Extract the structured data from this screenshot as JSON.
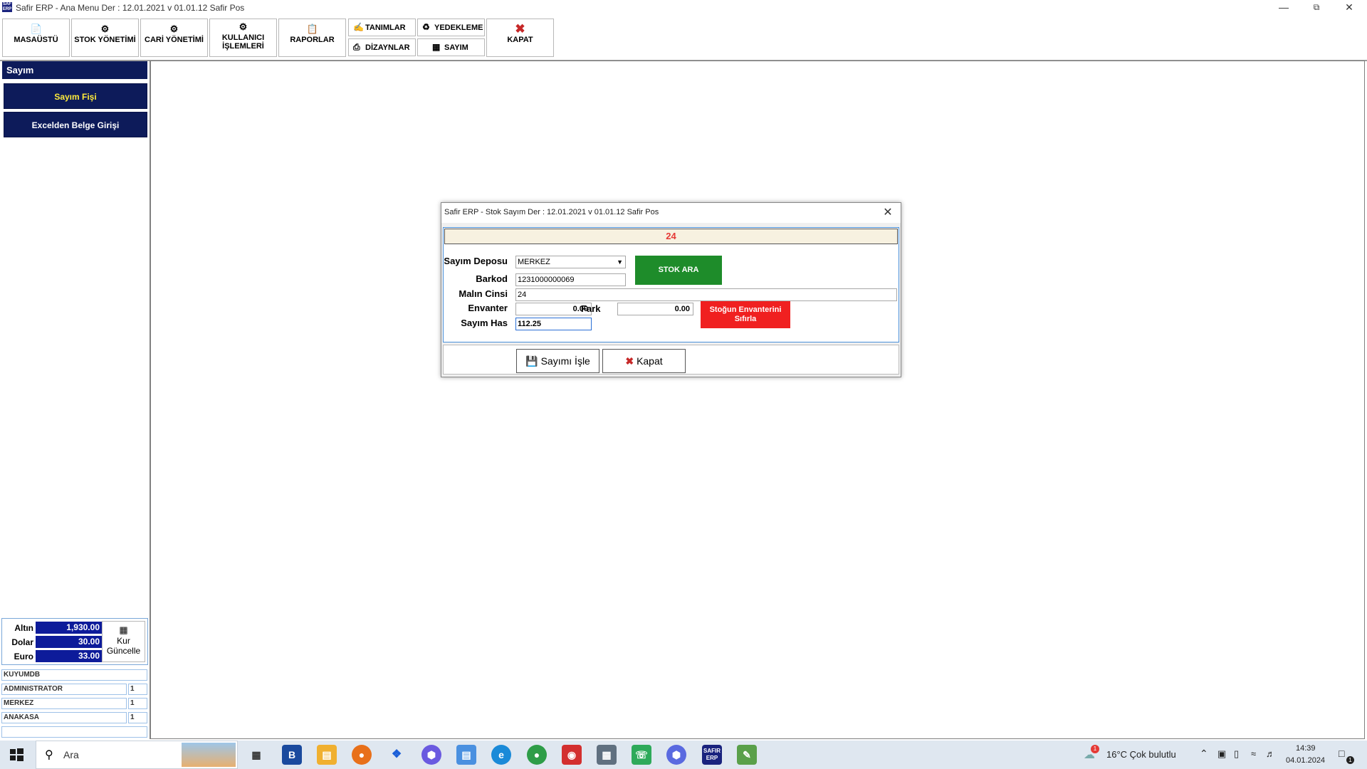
{
  "window": {
    "title": "Safir ERP - Ana Menu  Der : 12.01.2021 v 01.01.12 Safir Pos",
    "logo_text": "Safir ERP"
  },
  "toolbar": {
    "masaustu": "MASAÜSTÜ",
    "stok": "STOK YÖNETİMİ",
    "cari": "CARİ YÖNETİMİ",
    "kullanici_line1": "KULLANICI",
    "kullanici_line2": "İŞLEMLERİ",
    "raporlar": "RAPORLAR",
    "tanimlar": "TANIMLAR",
    "dizaynlar": "DİZAYNLAR",
    "yedekleme": "YEDEKLEME",
    "sayim": "SAYIM",
    "kapat": "KAPAT"
  },
  "sidebar": {
    "header": "Sayım",
    "items": [
      {
        "label": "Sayım Fişi"
      },
      {
        "label": "Excelden Belge Girişi"
      }
    ],
    "rates": [
      {
        "label": "Altın",
        "value": "1,930.00"
      },
      {
        "label": "Dolar",
        "value": "30.00"
      },
      {
        "label": "Euro",
        "value": "33.00"
      }
    ],
    "kur_button_line1": "Kur",
    "kur_button_line2": "Güncelle",
    "info": [
      {
        "name": "KUYUMDB",
        "value": ""
      },
      {
        "name": "ADMINISTRATOR",
        "value": "1"
      },
      {
        "name": "MERKEZ",
        "value": "1"
      },
      {
        "name": "ANAKASA",
        "value": "1"
      }
    ]
  },
  "dialog": {
    "title": "Safir ERP - Stok Sayım  Der : 12.01.2021 v 01.01.12 Safir Pos",
    "banner": "24",
    "labels": {
      "depo": "Sayım Deposu",
      "barkod": "Barkod",
      "cinsi": "Malın Cinsi",
      "envanter": "Envanter",
      "fark": "Fark",
      "sayim_has": "Sayım Has"
    },
    "values": {
      "depo": "MERKEZ",
      "barkod": "1231000000069",
      "cinsi": "24",
      "envanter": "0.00",
      "fark": "0.00",
      "sayim_has": "112.25"
    },
    "stok_ara": "STOK ARA",
    "reset_line1": "Stoğun Envanterini",
    "reset_line2": "Sıfırla",
    "save_button": "Sayımı İşle",
    "close_button": "Kapat"
  },
  "taskbar": {
    "search_placeholder": "Ara",
    "weather": "16°C  Çok bulutlu",
    "time": "14:39",
    "date": "04.01.2024",
    "notification_count": "1",
    "weather_badge": "1"
  }
}
